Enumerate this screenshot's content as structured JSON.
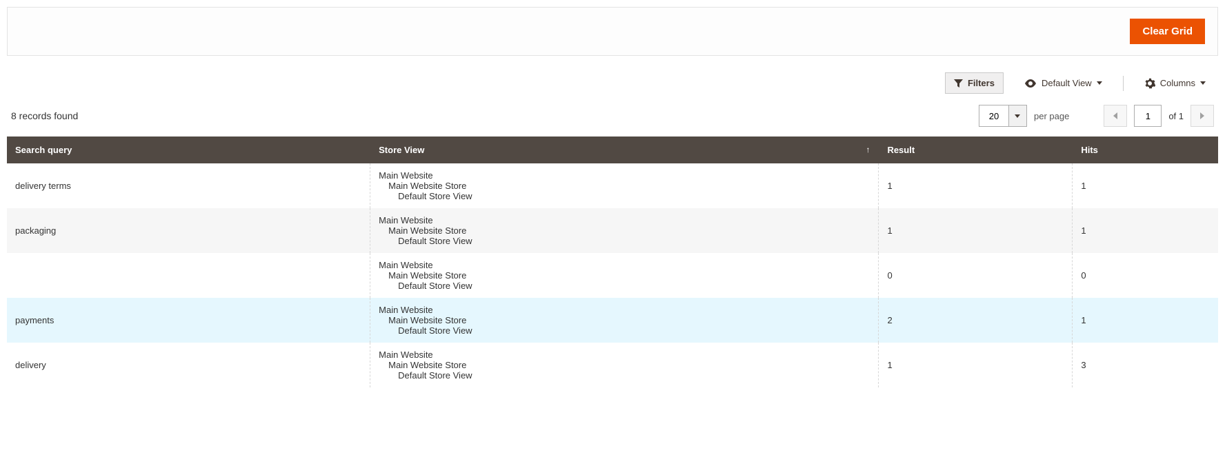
{
  "topbar": {
    "clear_grid": "Clear Grid"
  },
  "toolbar": {
    "filters": "Filters",
    "default_view": "Default View",
    "columns": "Columns"
  },
  "pager": {
    "records_found": "8 records found",
    "page_size": "20",
    "per_page_label": "per page",
    "current_page": "1",
    "of_label": "of 1"
  },
  "columns": {
    "search_query": "Search query",
    "store_view": "Store View",
    "result": "Result",
    "hits": "Hits",
    "sort_indicator": "↑"
  },
  "store_hierarchy": {
    "l1": "Main Website",
    "l2": "Main Website Store",
    "l3": "Default Store View"
  },
  "rows": [
    {
      "query": "delivery terms",
      "result": "1",
      "hits": "1",
      "highlight": false
    },
    {
      "query": "packaging",
      "result": "1",
      "hits": "1",
      "highlight": false
    },
    {
      "query": "",
      "result": "0",
      "hits": "0",
      "highlight": false
    },
    {
      "query": "payments",
      "result": "2",
      "hits": "1",
      "highlight": true
    },
    {
      "query": "delivery",
      "result": "1",
      "hits": "3",
      "highlight": false
    }
  ]
}
